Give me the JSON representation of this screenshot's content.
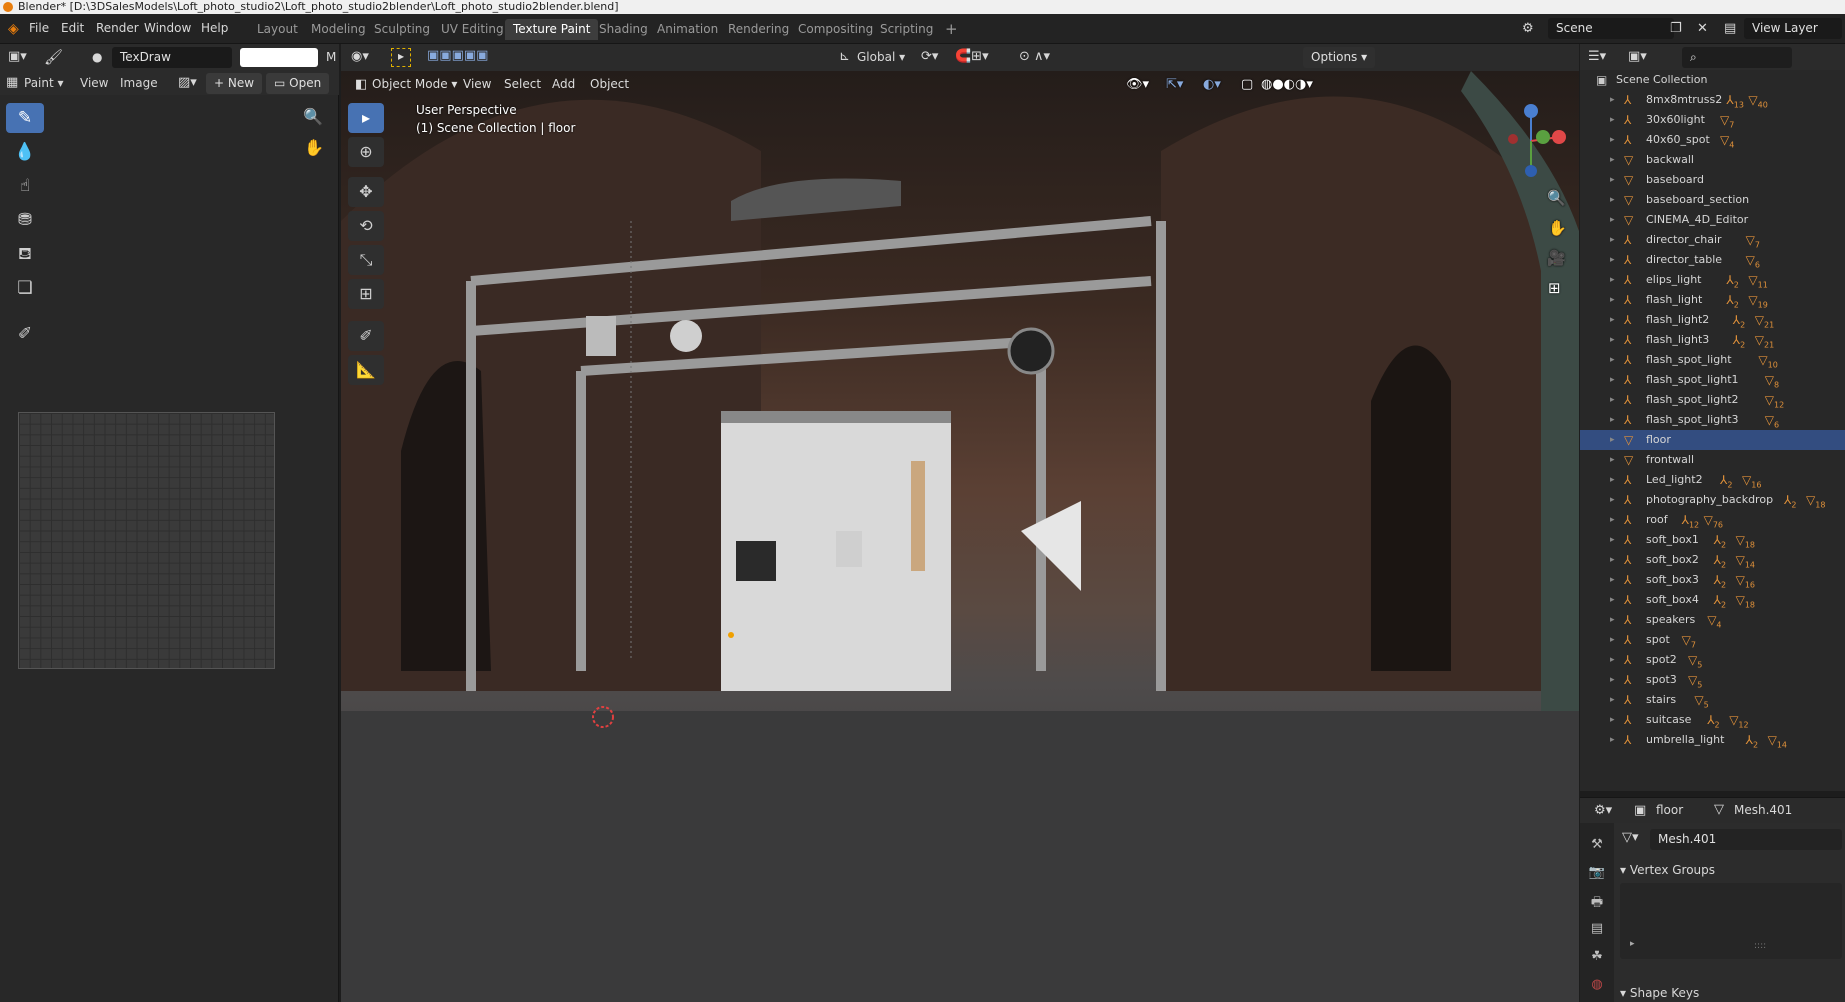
{
  "window": {
    "title": "Blender* [D:\\3DSalesModels\\Loft_photo_studio2\\Loft_photo_studio2blender\\Loft_photo_studio2blender.blend]"
  },
  "menu": [
    "File",
    "Edit",
    "Render",
    "Window",
    "Help"
  ],
  "workspaces": [
    {
      "label": "Layout",
      "active": false
    },
    {
      "label": "Modeling",
      "active": false
    },
    {
      "label": "Sculpting",
      "active": false
    },
    {
      "label": "UV Editing",
      "active": false
    },
    {
      "label": "Texture Paint",
      "active": true
    },
    {
      "label": "Shading",
      "active": false
    },
    {
      "label": "Animation",
      "active": false
    },
    {
      "label": "Rendering",
      "active": false
    },
    {
      "label": "Compositing",
      "active": false
    },
    {
      "label": "Scripting",
      "active": false
    }
  ],
  "scene": {
    "label": "Scene",
    "view_layer": "View Layer"
  },
  "image_editor": {
    "brush_name": "TexDraw",
    "mode": "Paint",
    "menus": [
      "View",
      "Image"
    ],
    "new_label": "New",
    "open_label": "Open",
    "cut_letter": "M"
  },
  "viewport": {
    "mode": "Object Mode",
    "menus": [
      "View",
      "Select",
      "Add",
      "Object"
    ],
    "transform_orientation": "Global",
    "options_label": "Options",
    "perspective_label": "User Perspective",
    "collection_label": "(1) Scene Collection | floor"
  },
  "outliner": {
    "root": "Scene Collection",
    "items": [
      {
        "name": "8mx8mtruss2",
        "badges": [
          "13",
          "40"
        ],
        "selected": false
      },
      {
        "name": "30x60light",
        "badges": [
          "7"
        ],
        "selected": false
      },
      {
        "name": "40x60_spot",
        "badges": [
          "4"
        ],
        "selected": false
      },
      {
        "name": "backwall",
        "badges": [],
        "selected": false
      },
      {
        "name": "baseboard",
        "badges": [],
        "selected": false
      },
      {
        "name": "baseboard_section",
        "badges": [],
        "selected": false
      },
      {
        "name": "CINEMA_4D_Editor",
        "badges": [],
        "selected": false
      },
      {
        "name": "director_chair",
        "badges": [
          "7"
        ],
        "selected": false
      },
      {
        "name": "director_table",
        "badges": [
          "6"
        ],
        "selected": false
      },
      {
        "name": "elips_light",
        "badges": [
          "2",
          "11"
        ],
        "selected": false
      },
      {
        "name": "flash_light",
        "badges": [
          "2",
          "19"
        ],
        "selected": false
      },
      {
        "name": "flash_light2",
        "badges": [
          "2",
          "21"
        ],
        "selected": false
      },
      {
        "name": "flash_light3",
        "badges": [
          "2",
          "21"
        ],
        "selected": false
      },
      {
        "name": "flash_spot_light",
        "badges": [
          "10"
        ],
        "selected": false
      },
      {
        "name": "flash_spot_light1",
        "badges": [
          "8"
        ],
        "selected": false
      },
      {
        "name": "flash_spot_light2",
        "badges": [
          "12"
        ],
        "selected": false
      },
      {
        "name": "flash_spot_light3",
        "badges": [
          "6"
        ],
        "selected": false
      },
      {
        "name": "floor",
        "badges": [],
        "selected": true
      },
      {
        "name": "frontwall",
        "badges": [],
        "selected": false
      },
      {
        "name": "Led_light2",
        "badges": [
          "2",
          "16"
        ],
        "selected": false
      },
      {
        "name": "photography_backdrop",
        "badges": [
          "2",
          "18"
        ],
        "selected": false
      },
      {
        "name": "roof",
        "badges": [
          "12",
          "76"
        ],
        "selected": false
      },
      {
        "name": "soft_box1",
        "badges": [
          "2",
          "18"
        ],
        "selected": false
      },
      {
        "name": "soft_box2",
        "badges": [
          "2",
          "14"
        ],
        "selected": false
      },
      {
        "name": "soft_box3",
        "badges": [
          "2",
          "16"
        ],
        "selected": false
      },
      {
        "name": "soft_box4",
        "badges": [
          "2",
          "18"
        ],
        "selected": false
      },
      {
        "name": "speakers",
        "badges": [
          "4"
        ],
        "selected": false
      },
      {
        "name": "spot",
        "badges": [
          "7"
        ],
        "selected": false
      },
      {
        "name": "spot2",
        "badges": [
          "5"
        ],
        "selected": false
      },
      {
        "name": "spot3",
        "badges": [
          "5"
        ],
        "selected": false
      },
      {
        "name": "stairs",
        "badges": [
          "5"
        ],
        "selected": false
      },
      {
        "name": "suitcase",
        "badges": [
          "2",
          "12"
        ],
        "selected": false
      },
      {
        "name": "umbrella_light",
        "badges": [
          "2",
          "14"
        ],
        "selected": false
      }
    ]
  },
  "properties": {
    "object": "floor",
    "mesh": "Mesh.401",
    "mesh_field": "Mesh.401",
    "vertex_groups": "Vertex Groups",
    "shape_keys": "Shape Keys"
  },
  "colors": {
    "accent": "#4772b3",
    "active_tab": "#3d3d3d",
    "orange_icon": "#e0913a",
    "selected_row": "#334d80"
  }
}
